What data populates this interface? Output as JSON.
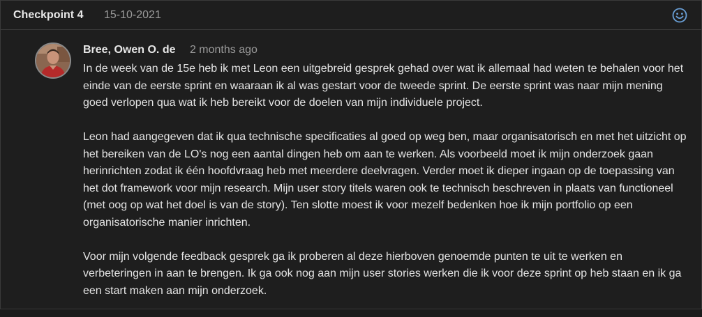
{
  "header": {
    "title": "Checkpoint 4",
    "date": "15-10-2021",
    "reaction_icon": "smiley-icon"
  },
  "comment": {
    "author": "Bree, Owen O. de",
    "time_ago": "2 months ago",
    "avatar_icon": "user-avatar",
    "paragraphs": [
      "In de week van de 15e heb ik met Leon een uitgebreid gesprek gehad over wat ik allemaal had weten te behalen voor het einde van de eerste sprint en waaraan ik al was gestart voor de tweede sprint. De eerste sprint was naar mijn mening goed verlopen qua wat ik heb bereikt voor de doelen van mijn individuele project.",
      "Leon had aangegeven dat ik qua technische specificaties al goed op weg ben, maar organisatorisch en met het uitzicht op het bereiken van de LO's nog een aantal dingen heb om aan te werken. Als voorbeeld moet ik mijn onderzoek gaan herinrichten zodat ik één hoofdvraag heb met meerdere deelvragen. Verder moet ik dieper ingaan op de toepassing van het dot framework voor mijn research. Mijn user story titels waren ook te technisch beschreven in plaats van functioneel (met oog op wat het doel is van de story). Ten slotte moest ik voor mezelf bedenken hoe ik mijn portfolio op een organisatorische manier inrichten.",
      "Voor mijn volgende feedback gesprek ga ik proberen al deze hierboven genoemde punten te uit te werken en verbeteringen in aan te brengen. Ik ga ook nog aan mijn user stories werken die ik voor deze sprint op heb staan en ik ga een start maken aan mijn onderzoek."
    ]
  },
  "colors": {
    "background": "#1e1e1e",
    "border": "#3a3a3a",
    "text": "#e4e4e4",
    "muted": "#9a9a9a",
    "accent": "#6aa0d8"
  }
}
